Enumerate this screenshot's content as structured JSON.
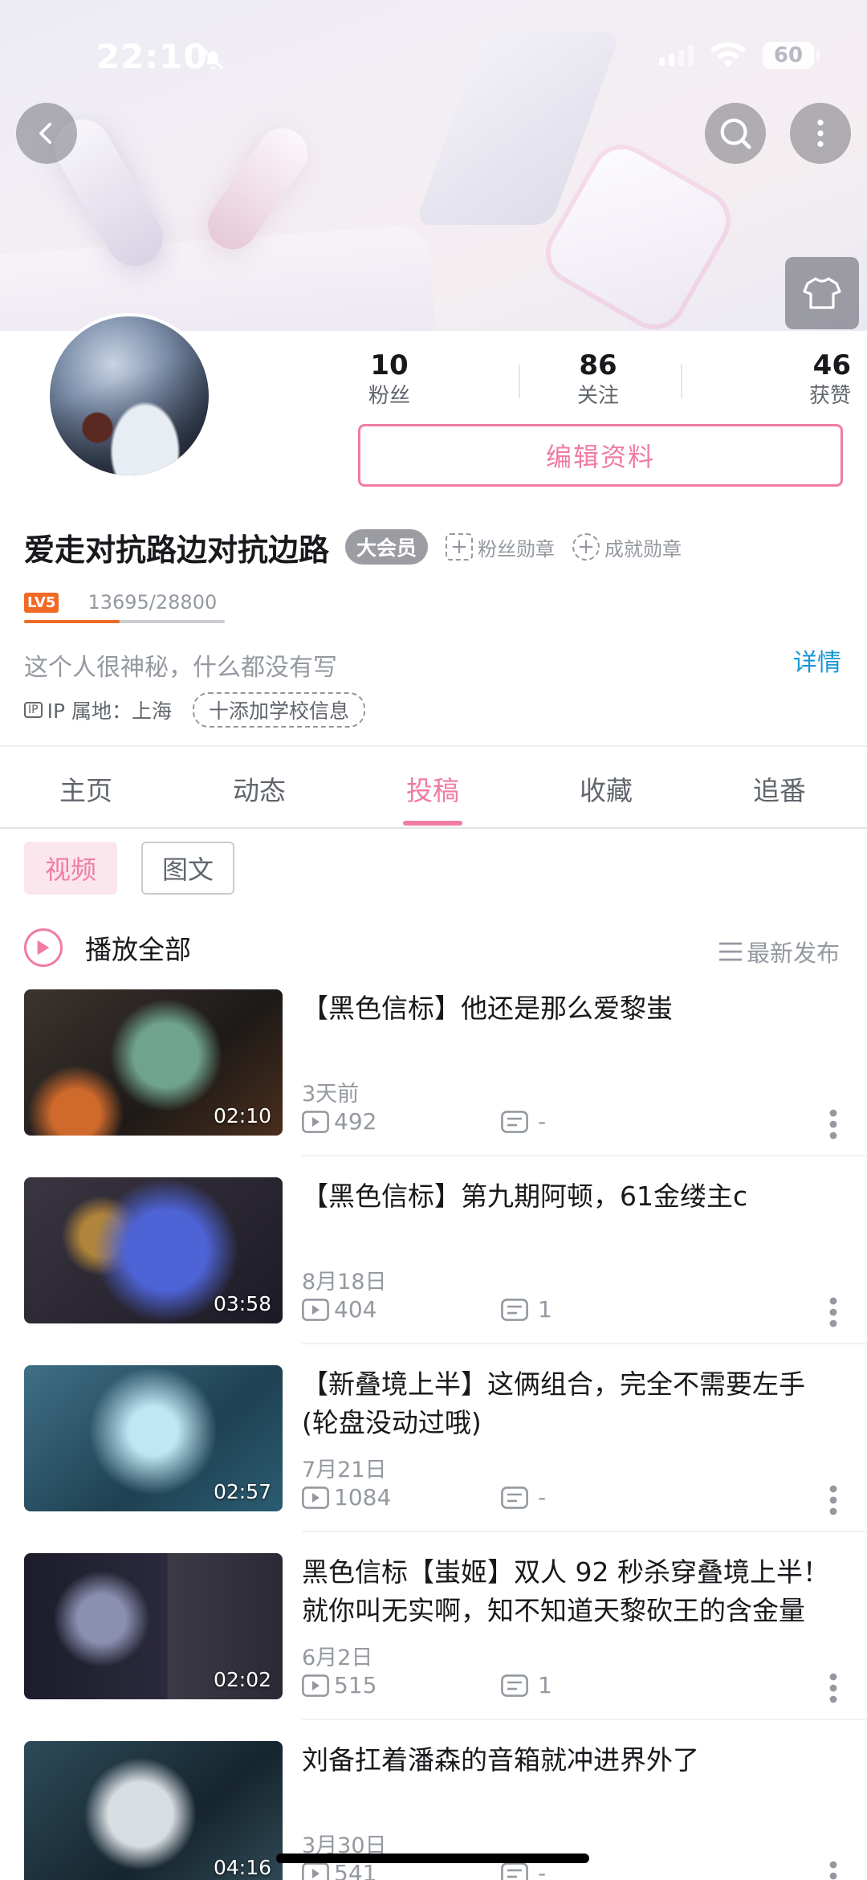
{
  "status_bar": {
    "time": "22:10",
    "battery": "60"
  },
  "stats": [
    {
      "value": "10",
      "label": "粉丝"
    },
    {
      "value": "86",
      "label": "关注"
    },
    {
      "value": "46",
      "label": "获赞"
    }
  ],
  "profile": {
    "edit_label": "编辑资料",
    "username": "爱走对抗路边对抗边路",
    "vip": "大会员",
    "fan_medal": "粉丝勋章",
    "achievement_medal": "成就勋章",
    "level_badge": "LV5",
    "exp": "13695/28800",
    "exp_progress": 0.4755,
    "signature": "这个人很神秘，什么都没有写",
    "details": "详情",
    "ip_chip": "IP",
    "ip_location": "IP 属地：上海",
    "add_school": "十添加学校信息"
  },
  "tabs": [
    {
      "label": "主页"
    },
    {
      "label": "动态"
    },
    {
      "label": "投稿",
      "active": true
    },
    {
      "label": "收藏"
    },
    {
      "label": "追番"
    }
  ],
  "content_filter": {
    "video": "视频",
    "article": "图文"
  },
  "play_all": "播放全部",
  "sort": "最新发布",
  "videos": [
    {
      "title": "【黑色信标】他还是那么爱黎蚩",
      "duration": "02:10",
      "date": "3天前",
      "plays": "492",
      "danmaku": "-"
    },
    {
      "title": "【黑色信标】第九期阿顿，61金缕主c",
      "duration": "03:58",
      "date": "8月18日",
      "plays": "404",
      "danmaku": "1"
    },
    {
      "title": "【新叠境上半】这俩组合，完全不需要左手(轮盘没动过哦)",
      "duration": "02:57",
      "date": "7月21日",
      "plays": "1084",
      "danmaku": "-"
    },
    {
      "title": "黑色信标【蚩姬】双人 92 秒杀穿叠境上半！就你叫无实啊，知不知道天黎砍王的含金量",
      "duration": "02:02",
      "date": "6月2日",
      "plays": "515",
      "danmaku": "1"
    },
    {
      "title": "刘备扛着潘森的音箱就冲进界外了",
      "duration": "04:16",
      "date": "3月30日",
      "plays": "541",
      "danmaku": "-"
    }
  ],
  "colors": {
    "accent": "#f07ca2",
    "link": "#1a97d7",
    "level": "#f06a26"
  },
  "icons": [
    "back-arrow-icon",
    "search-icon",
    "more-vertical-icon",
    "tshirt-icon",
    "bell-off-icon",
    "wifi-icon",
    "play-icon",
    "danmaku-icon",
    "sort-icon"
  ]
}
